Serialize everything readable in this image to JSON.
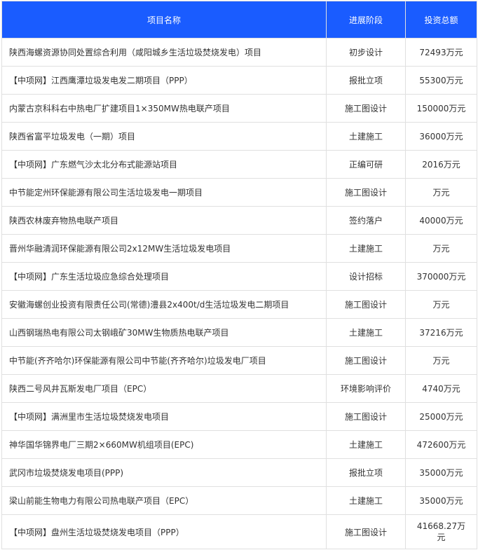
{
  "headers": {
    "name": "项目名称",
    "stage": "进展阶段",
    "amount": "投资总额"
  },
  "rows": [
    {
      "name": "陕西海螺资源协同处置综合利用（咸阳城乡生活垃圾焚烧发电）项目",
      "stage": "初步设计",
      "amount": "72493万元"
    },
    {
      "name": "【中项网】江西鹰潭垃圾发电发二期项目（PPP）",
      "stage": "报批立项",
      "amount": "55300万元"
    },
    {
      "name": "内蒙古京科科右中热电厂扩建项目1×350MW热电联产项目",
      "stage": "施工图设计",
      "amount": "150000万元"
    },
    {
      "name": "陕西省富平垃圾发电（一期）项目",
      "stage": "土建施工",
      "amount": "36000万元"
    },
    {
      "name": "【中项网】广东燃气沙太北分布式能源站项目",
      "stage": "正编可研",
      "amount": "2016万元"
    },
    {
      "name": "中节能定州环保能源有限公司生活垃圾发电一期项目",
      "stage": "施工图设计",
      "amount": "万元"
    },
    {
      "name": "陕西农林废弃物热电联产项目",
      "stage": "签约落户",
      "amount": "40000万元"
    },
    {
      "name": "晋州华融清润环保能源有限公司2x12MW生活垃圾发电项目",
      "stage": "土建施工",
      "amount": "万元"
    },
    {
      "name": "【中项网】广东生活垃圾应急综合处理项目",
      "stage": "设计招标",
      "amount": "370000万元"
    },
    {
      "name": "安徽海螺创业投资有限责任公司(常德)澧县2x400t/d生活垃圾发电二期项目",
      "stage": "施工图设计",
      "amount": "万元"
    },
    {
      "name": "山西钢瑞热电有限公司太钢峨矿30MW生物质热电联产项目",
      "stage": "土建施工",
      "amount": "37216万元"
    },
    {
      "name": "中节能(齐齐哈尔)环保能源有限公司中节能(齐齐哈尔)垃圾发电厂项目",
      "stage": "施工图设计",
      "amount": "万元"
    },
    {
      "name": "陕西二号风井瓦斯发电厂项目（EPC）",
      "stage": "环境影响评价",
      "amount": "4740万元"
    },
    {
      "name": "【中项网】满洲里市生活垃圾焚烧发电项目",
      "stage": "施工图设计",
      "amount": "25000万元"
    },
    {
      "name": "神华国华锦界电厂三期2×660MW机组项目(EPC)",
      "stage": "土建施工",
      "amount": "472600万元"
    },
    {
      "name": "武冈市垃圾焚烧发电项目(PPP)",
      "stage": "报批立项",
      "amount": "35000万元"
    },
    {
      "name": "梁山前能生物电力有限公司热电联产项目（EPC）",
      "stage": "土建施工",
      "amount": "35000万元"
    },
    {
      "name": "【中项网】盘州生活垃圾焚烧发电项目（PPP）",
      "stage": "施工图设计",
      "amount": "41668.27万元"
    }
  ]
}
